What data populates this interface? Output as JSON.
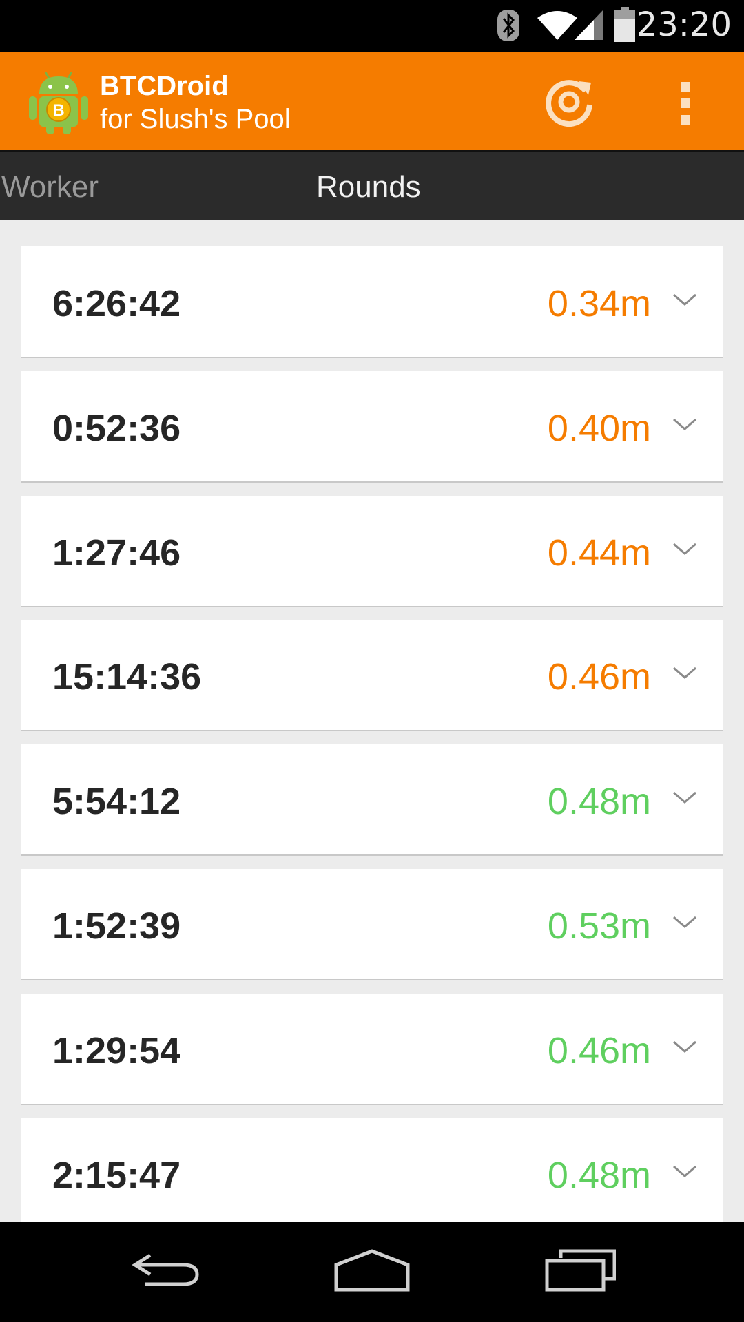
{
  "status_bar": {
    "time": "23:20",
    "icons": [
      "bluetooth-icon",
      "wifi-icon",
      "signal-icon",
      "battery-icon"
    ]
  },
  "action_bar": {
    "title": "BTCDroid",
    "subtitle": "for Slush's Pool",
    "actions": [
      "refresh-icon",
      "overflow-menu-icon"
    ]
  },
  "tabs": [
    {
      "label": "Worker",
      "selected": false
    },
    {
      "label": "Rounds",
      "selected": true
    }
  ],
  "rounds": [
    {
      "duration": "6:26:42",
      "value": "0.34m",
      "color": "#f57c00"
    },
    {
      "duration": "0:52:36",
      "value": "0.40m",
      "color": "#f57c00"
    },
    {
      "duration": "1:27:46",
      "value": "0.44m",
      "color": "#f57c00"
    },
    {
      "duration": "15:14:36",
      "value": "0.46m",
      "color": "#f57c00"
    },
    {
      "duration": "5:54:12",
      "value": "0.48m",
      "color": "#5fcf5f"
    },
    {
      "duration": "1:52:39",
      "value": "0.53m",
      "color": "#5fcf5f"
    },
    {
      "duration": "1:29:54",
      "value": "0.46m",
      "color": "#5fcf5f"
    },
    {
      "duration": "2:15:47",
      "value": "0.48m",
      "color": "#5fcf5f"
    }
  ],
  "colors": {
    "accent": "#f57c00",
    "good": "#5fcf5f"
  },
  "nav_bar": [
    "back-icon",
    "home-icon",
    "recents-icon"
  ]
}
